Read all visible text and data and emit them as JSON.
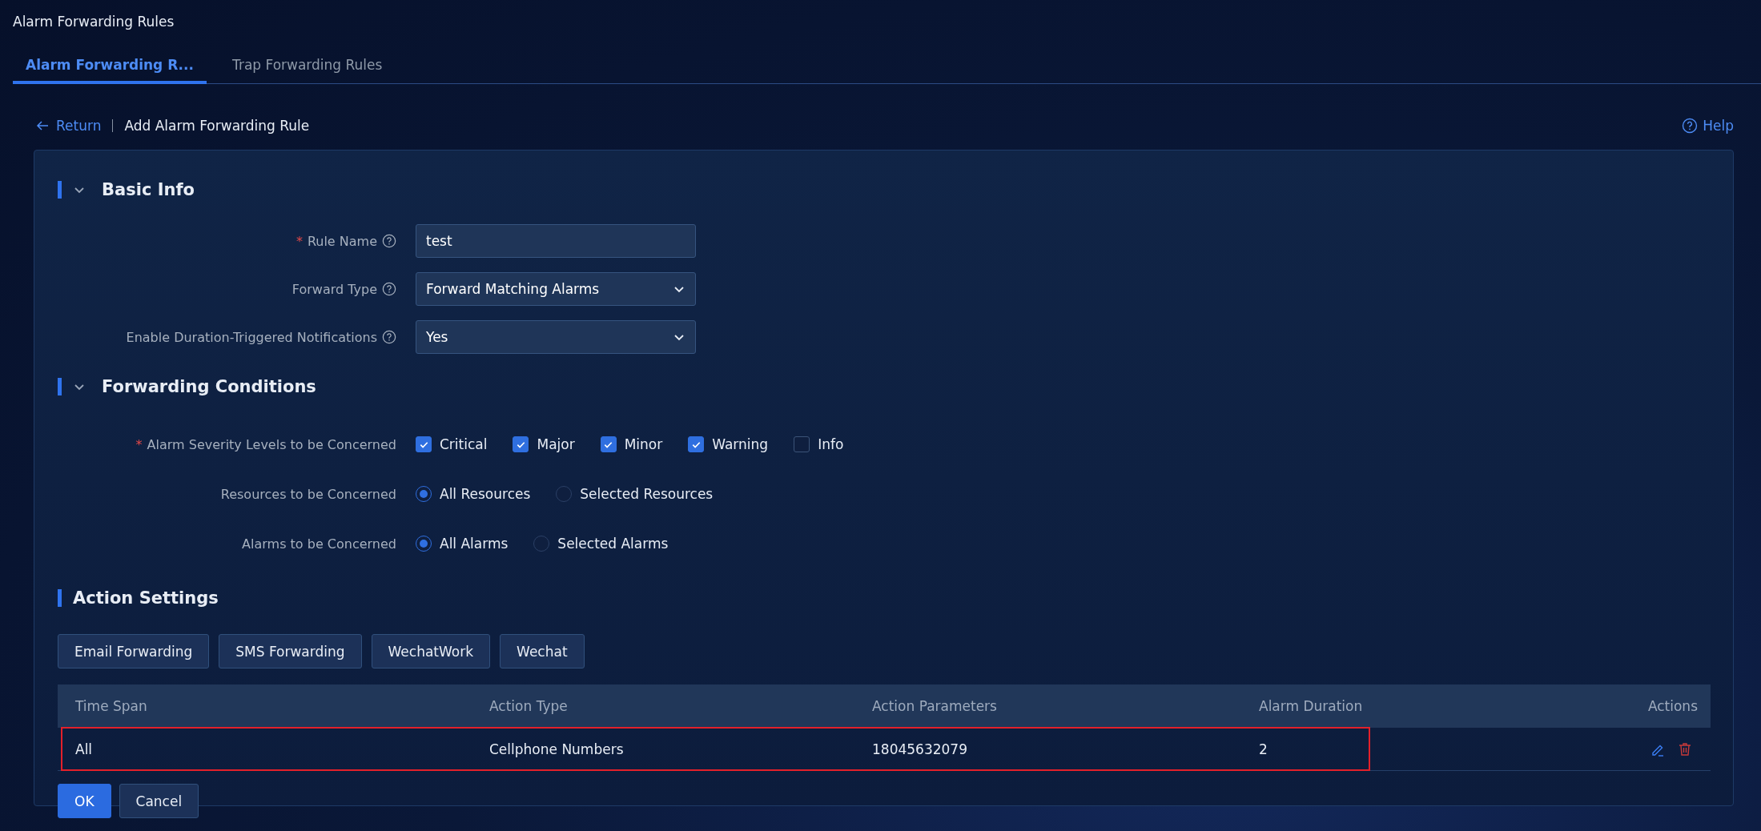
{
  "page": {
    "title": "Alarm Forwarding Rules"
  },
  "tabs": [
    {
      "label": "Alarm Forwarding R...",
      "selected": true
    },
    {
      "label": "Trap Forwarding Rules",
      "selected": false
    }
  ],
  "breadcrumb": {
    "back": "Return",
    "current": "Add Alarm Forwarding Rule",
    "help": "Help"
  },
  "sections": [
    {
      "title": "Basic Info",
      "collapsible": true,
      "fields": [
        {
          "kind": "input",
          "label": "Rule Name",
          "required_mark": "*",
          "help": true,
          "value": "test"
        },
        {
          "kind": "select",
          "label": "Forward Type",
          "help": true,
          "value": "Forward Matching Alarms"
        },
        {
          "kind": "select",
          "label": "Enable Duration-Triggered Notifications",
          "help": true,
          "value": "Yes"
        }
      ]
    },
    {
      "title": "Forwarding Conditions",
      "collapsible": true,
      "fields": [
        {
          "kind": "checkboxes",
          "label": "Alarm Severity Levels to be Concerned",
          "required_mark": "*",
          "help": false,
          "options": [
            {
              "label": "Critical",
              "checked": true
            },
            {
              "label": "Major",
              "checked": true
            },
            {
              "label": "Minor",
              "checked": true
            },
            {
              "label": "Warning",
              "checked": true
            },
            {
              "label": "Info",
              "checked": false
            }
          ]
        },
        {
          "kind": "radios",
          "label": "Resources to be Concerned",
          "help": false,
          "options": [
            {
              "label": "All Resources",
              "selected": true
            },
            {
              "label": "Selected Resources",
              "selected": false
            }
          ]
        },
        {
          "kind": "radios",
          "label": "Alarms to be Concerned",
          "help": false,
          "options": [
            {
              "label": "All Alarms",
              "selected": true
            },
            {
              "label": "Selected Alarms",
              "selected": false
            }
          ]
        }
      ]
    },
    {
      "title": "Action Settings",
      "collapsible": false
    }
  ],
  "action_buttons": [
    "Email Forwarding",
    "SMS Forwarding",
    "WechatWork",
    "Wechat"
  ],
  "table": {
    "columns": [
      "Time Span",
      "Action Type",
      "Action Parameters",
      "Alarm Duration",
      "Actions"
    ],
    "rows": [
      {
        "cells": [
          "All",
          "Cellphone Numbers",
          "18045632079",
          "2"
        ],
        "highlighted": true
      }
    ]
  },
  "footer_buttons": [
    {
      "label": "OK",
      "primary": true
    },
    {
      "label": "Cancel",
      "primary": false
    }
  ]
}
